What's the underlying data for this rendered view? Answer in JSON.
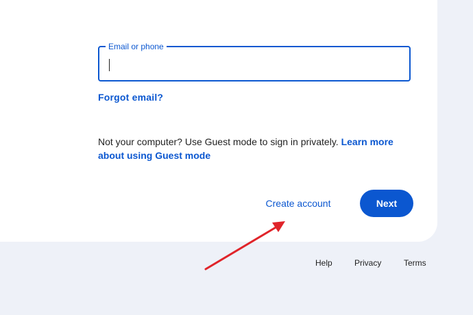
{
  "signin": {
    "email_label": "Email or phone",
    "email_value": "",
    "forgot_email": "Forgot email?",
    "guest_text": "Not your computer? Use Guest mode to sign in privately.",
    "guest_link": "Learn more about using Guest mode",
    "create_account": "Create account",
    "next": "Next"
  },
  "footer": {
    "help": "Help",
    "privacy": "Privacy",
    "terms": "Terms"
  },
  "annotation": {
    "arrow_color": "#e0242a",
    "arrow_icon": "red-arrow-annotation"
  },
  "colors": {
    "accent": "#0b57d0",
    "page_background": "#eef1f8"
  }
}
